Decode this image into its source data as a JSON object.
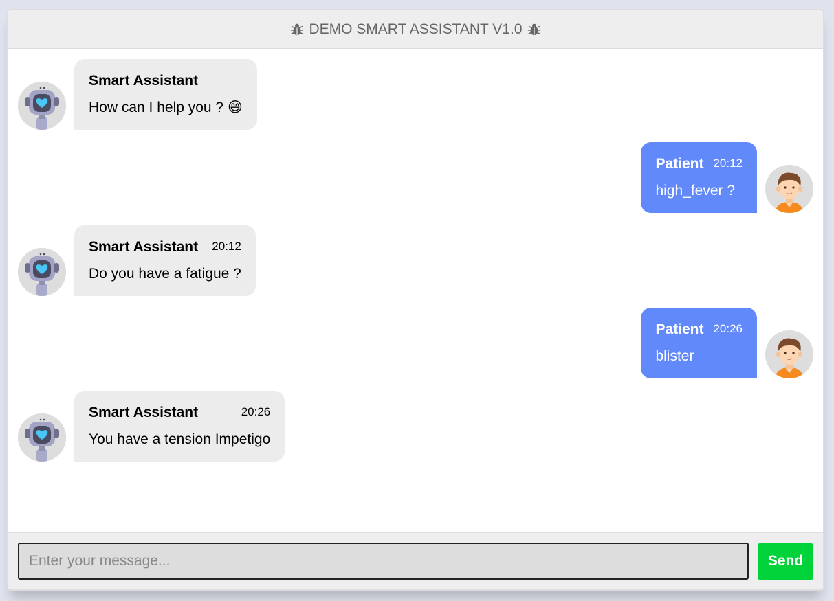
{
  "header": {
    "title": "DEMO SMART ASSISTANT V1.0",
    "icon_left": "bug-icon",
    "icon_right": "bug-icon"
  },
  "messages": [
    {
      "side": "left",
      "sender": "Smart Assistant",
      "time": "",
      "text": "How can I help you ? 😄",
      "avatar": "robot-avatar"
    },
    {
      "side": "right",
      "sender": "Patient",
      "time": "20:12",
      "text": "high_fever ?",
      "avatar": "user-avatar"
    },
    {
      "side": "left",
      "sender": "Smart Assistant",
      "time": "20:12",
      "text": "Do you have a fatigue ?",
      "avatar": "robot-avatar"
    },
    {
      "side": "right",
      "sender": "Patient",
      "time": "20:26",
      "text": "blister",
      "avatar": "user-avatar"
    },
    {
      "side": "left",
      "sender": "Smart Assistant",
      "time": "20:26",
      "text": "You have a tension Impetigo",
      "avatar": "robot-avatar"
    }
  ],
  "input": {
    "placeholder": "Enter your message...",
    "value": ""
  },
  "send_button": {
    "label": "Send"
  },
  "colors": {
    "bot_bubble": "#ececec",
    "user_bubble": "#6289fa",
    "send_button": "#00d23a",
    "header_bg": "#eeeeee"
  }
}
